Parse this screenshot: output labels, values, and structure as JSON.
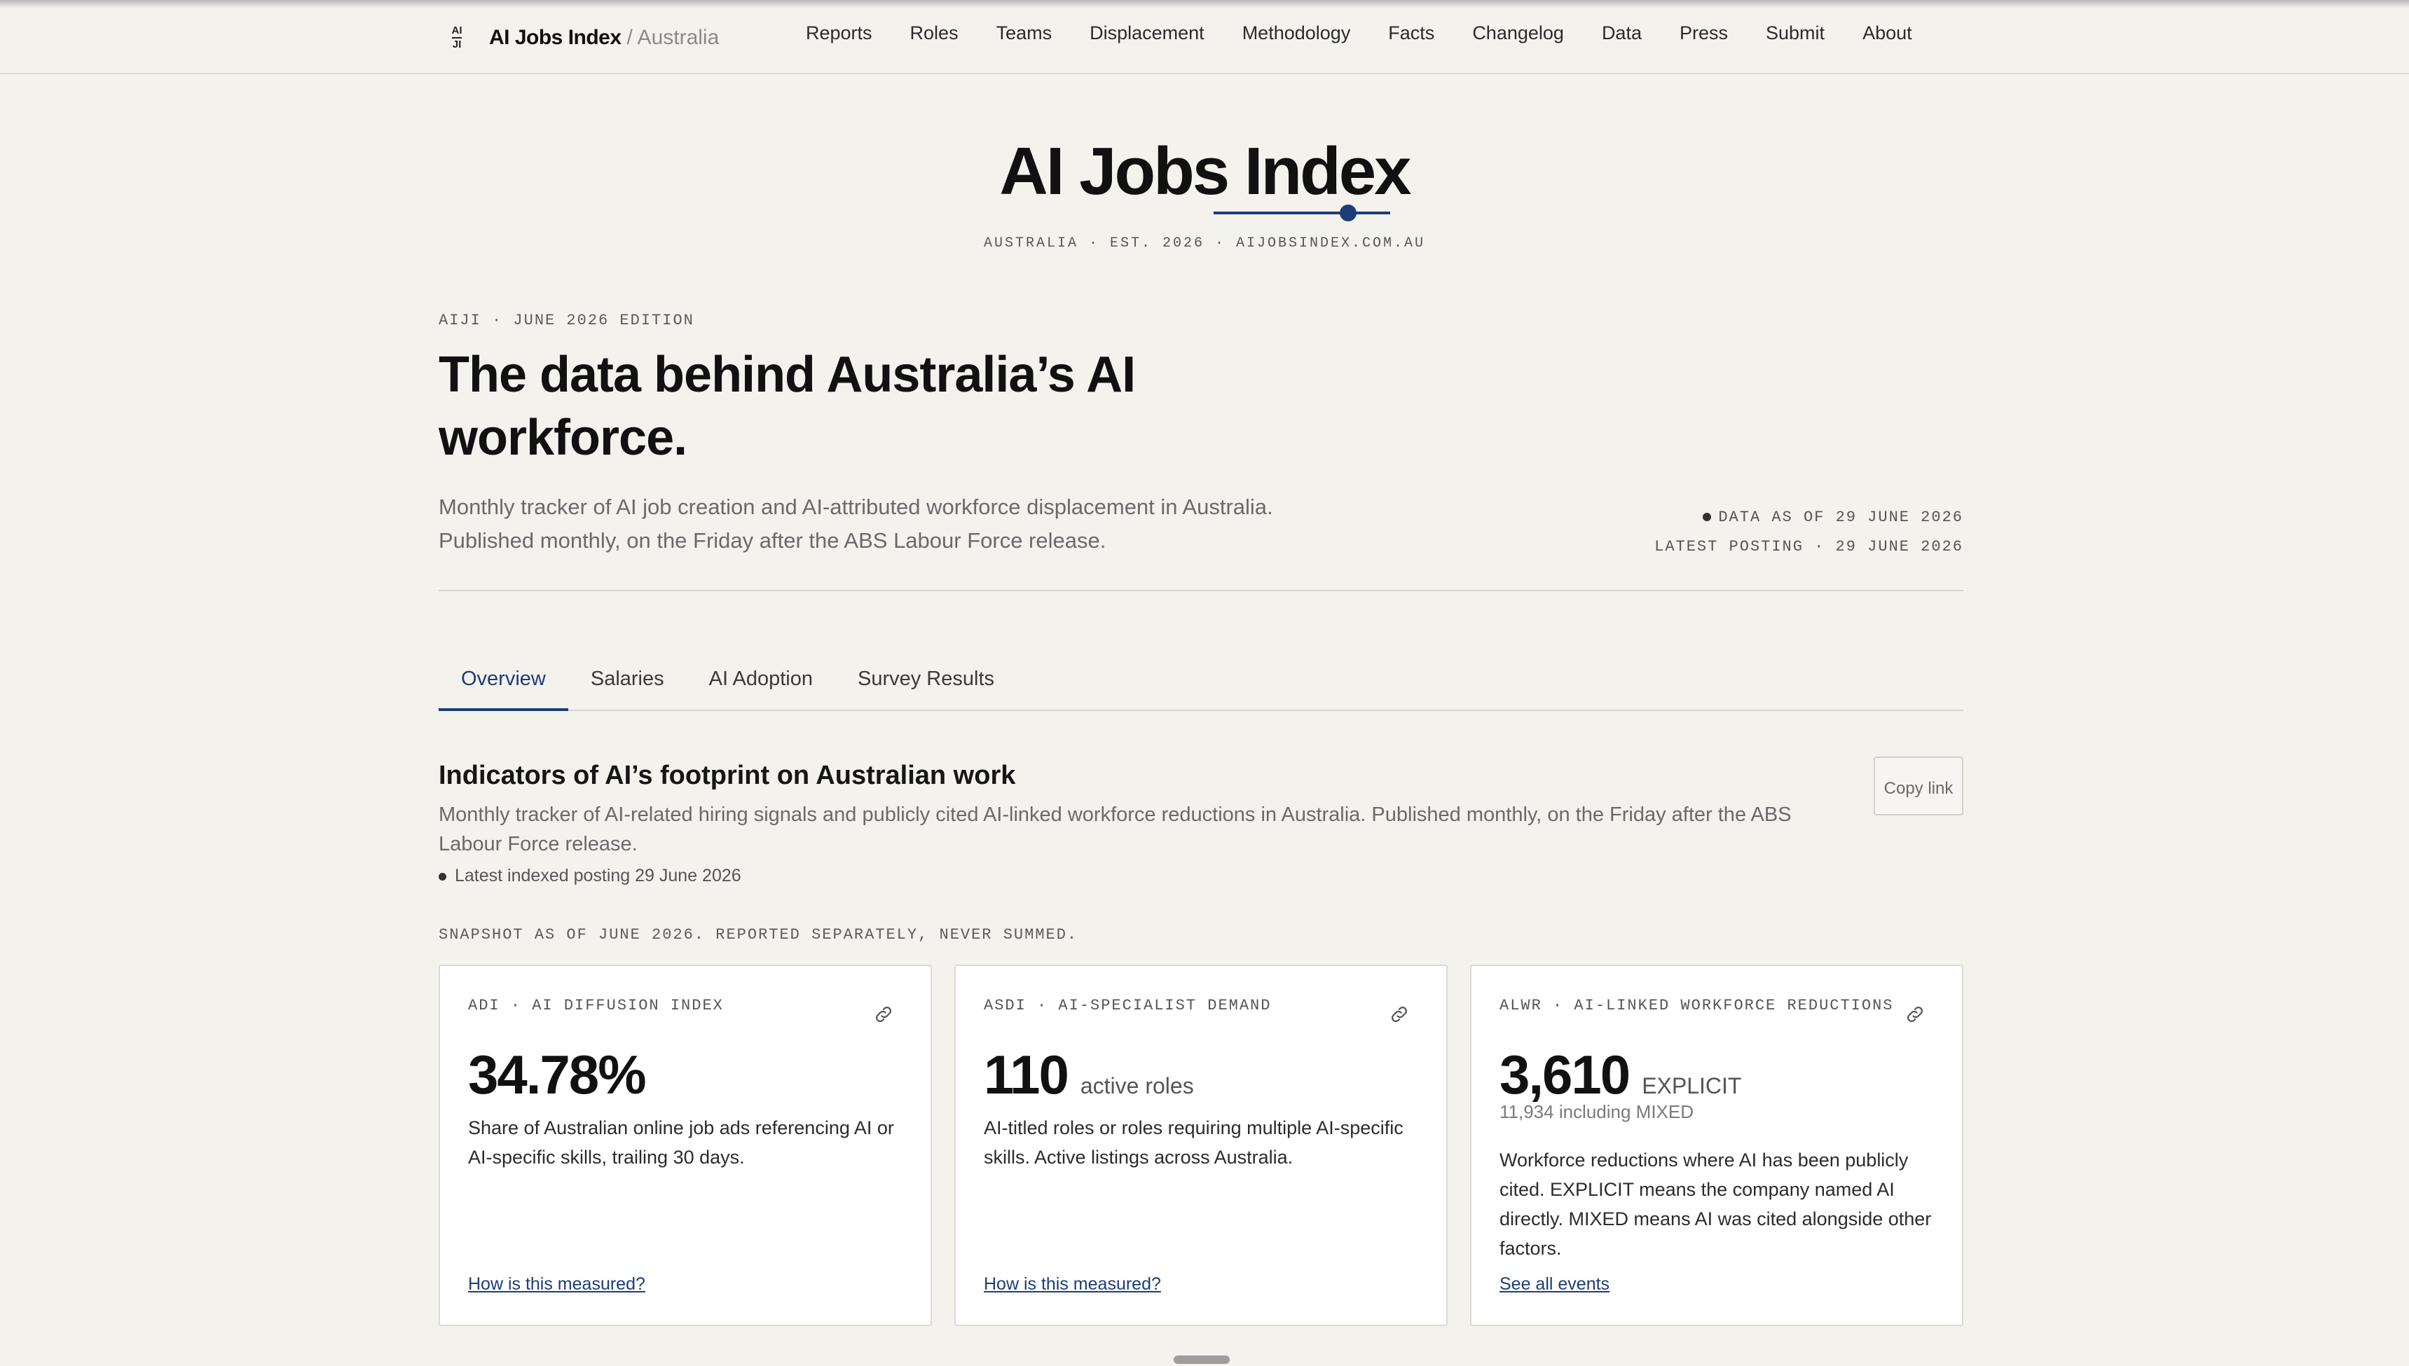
{
  "nav": {
    "logo_text_top": "AI",
    "logo_text_bottom": "JI",
    "brand": "AI Jobs Index",
    "brand_suffix": "/ Australia",
    "links": [
      "Reports",
      "Roles",
      "Teams",
      "Displacement",
      "Methodology",
      "Facts",
      "Changelog",
      "Data",
      "Press",
      "Submit",
      "About"
    ]
  },
  "masthead": {
    "title": "AI Jobs Index",
    "subtitle": "AUSTRALIA · EST. 2026 · AIJOBSINDEX.COM.AU",
    "accent_color": "#1c3d7a"
  },
  "hero": {
    "edition": "AIJI · JUNE 2026 EDITION",
    "title": "The data behind Australia’s AI workforce.",
    "description_line1": "Monthly tracker of AI job creation and AI-attributed workforce displacement in Australia.",
    "description_line2": "Published monthly, on the Friday after the ABS Labour Force release.",
    "data_as_of": "DATA AS OF 29 JUNE 2026",
    "latest_posting": "LATEST POSTING · 29 JUNE 2026"
  },
  "tabs": [
    {
      "label": "Overview",
      "active": true
    },
    {
      "label": "Salaries",
      "active": false
    },
    {
      "label": "AI Adoption",
      "active": false
    },
    {
      "label": "Survey Results",
      "active": false
    }
  ],
  "section": {
    "title": "Indicators of AI’s footprint on Australian work",
    "copy_button": "Copy link",
    "description": "Monthly tracker of AI-related hiring signals and publicly cited AI-linked workforce reductions in Australia. Published monthly, on the Friday after the ABS Labour Force release.",
    "latest_indexed": "Latest indexed posting 29 June 2026",
    "snapshot_note": "SNAPSHOT AS OF JUNE 2026. REPORTED SEPARATELY, NEVER SUMMED."
  },
  "cards": [
    {
      "label": "ADI · AI DIFFUSION INDEX",
      "value": "34.78%",
      "unit": "",
      "subvalue": "",
      "description": "Share of Australian online job ads referencing AI or AI-specific skills, trailing 30 days.",
      "cta": "How is this measured?",
      "icon": "link-icon"
    },
    {
      "label": "ASDI · AI-SPECIALIST DEMAND",
      "value": "110",
      "unit": "active roles",
      "subvalue": "",
      "description": "AI-titled roles or roles requiring multiple AI-specific skills. Active listings across Australia.",
      "cta": "How is this measured?",
      "icon": "link-icon"
    },
    {
      "label": "ALWR · AI-LINKED WORKFORCE REDUCTIONS",
      "value": "3,610",
      "unit": "EXPLICIT",
      "subvalue": "11,934 including MIXED",
      "description": "Workforce reductions where AI has been publicly cited. EXPLICIT means the company named AI directly. MIXED means AI was cited alongside other factors.",
      "cta": "See all events",
      "icon": "link-icon"
    }
  ]
}
